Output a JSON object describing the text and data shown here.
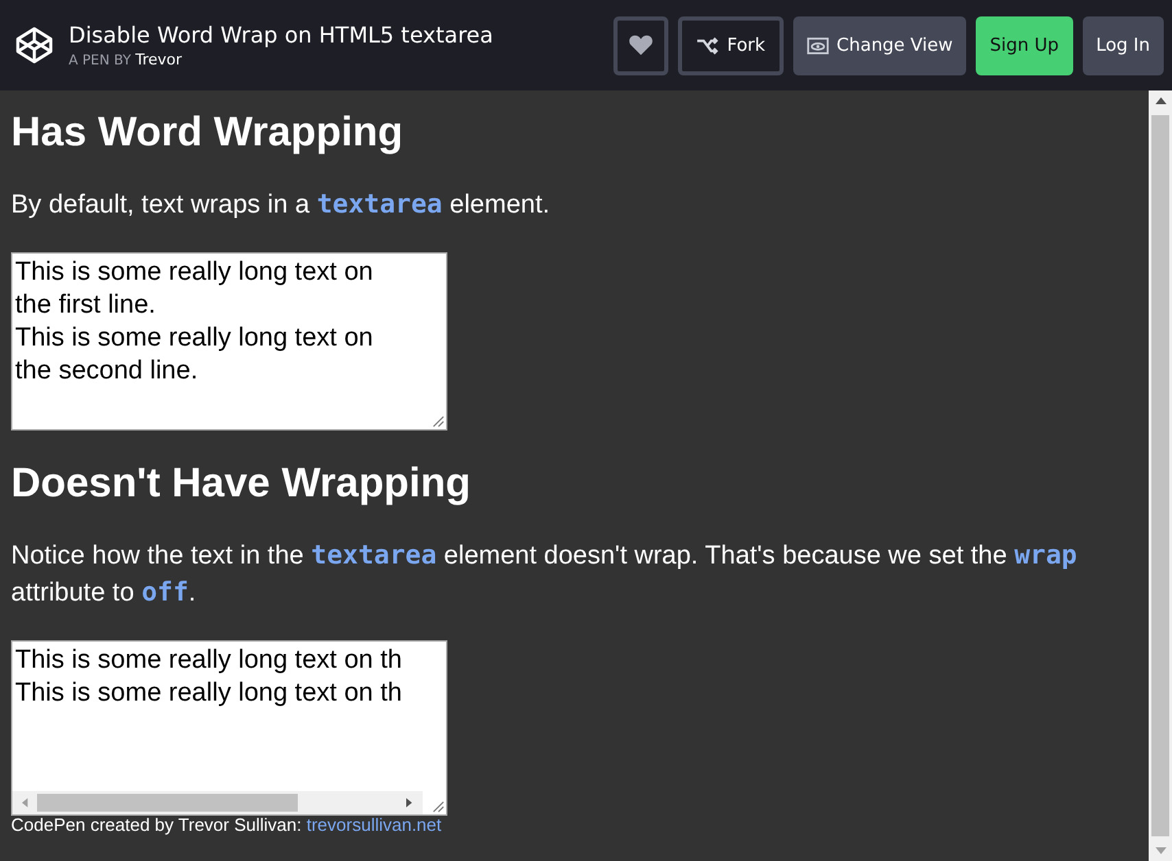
{
  "header": {
    "title": "Disable Word Wrap on HTML5 textarea",
    "byline": "A PEN BY",
    "author": "Trevor",
    "buttons": [
      {
        "kind": "heart"
      },
      {
        "kind": "fork",
        "label": "Fork"
      },
      {
        "kind": "view",
        "label": "Change View"
      },
      {
        "kind": "signup",
        "label": "Sign Up"
      },
      {
        "kind": "login",
        "label": "Log In"
      }
    ]
  },
  "sections": [
    {
      "heading": "Has Word Wrapping",
      "paragraph": "By default, text wraps in a **textarea** element.",
      "textarea": {
        "wrap": true,
        "lines": [
          "This is some really long text on",
          "the first line.",
          "This is some really long text on",
          "the second line."
        ]
      }
    },
    {
      "heading": "Doesn't Have Wrapping",
      "paragraph": "Notice how the text in the **textarea** element doesn't wrap. That's because we set the **wrap** attribute to **off**.",
      "textarea": {
        "wrap": false,
        "lines": [
          "This is some really long text on th",
          "This is some really long text on th"
        ]
      }
    }
  ],
  "footer": {
    "text": "CodePen created by Trevor Sullivan:",
    "link": "trevorsullivan.net"
  }
}
